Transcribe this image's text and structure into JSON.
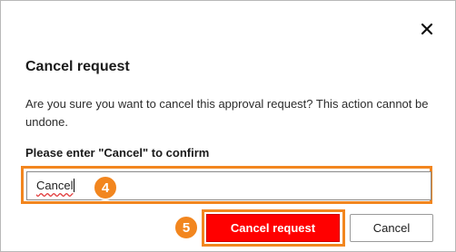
{
  "dialog": {
    "title": "Cancel request",
    "description": "Are you sure you want to cancel this approval request? This action cannot be undone.",
    "confirm_label": "Please enter \"Cancel\" to confirm",
    "input_value": "Cancel",
    "close_icon": "close-icon",
    "primary_button": "Cancel request",
    "secondary_button": "Cancel"
  },
  "annotations": {
    "step_input": "4",
    "step_button": "5",
    "highlight_color": "#f2861f"
  },
  "colors": {
    "danger": "#ff0000",
    "text": "#1b1b1b"
  }
}
